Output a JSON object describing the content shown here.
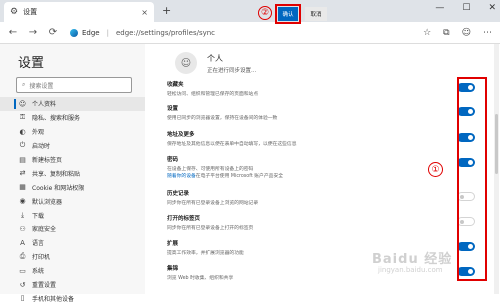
{
  "tab": {
    "title": "设置",
    "close": "×"
  },
  "newtab": "+",
  "window": {
    "minimize": "—",
    "maximize": "☐",
    "close": "✕"
  },
  "addr": {
    "back": "←",
    "forward": "→",
    "refresh": "⟳",
    "brand": "Edge",
    "sep": "|",
    "url": "edge://settings/profiles/sync",
    "star": "☆",
    "collections": "⧉",
    "more": "⋯"
  },
  "sidebar": {
    "title": "设置",
    "search_placeholder": "搜索设置",
    "items": [
      {
        "icon": "☺",
        "label": "个人资料",
        "active": true
      },
      {
        "icon": "⚿",
        "label": "隐私、搜索和服务"
      },
      {
        "icon": "◐",
        "label": "外观"
      },
      {
        "icon": "⏻",
        "label": "启动时"
      },
      {
        "icon": "▤",
        "label": "新建标签页"
      },
      {
        "icon": "⇄",
        "label": "共享、复制和粘贴"
      },
      {
        "icon": "▦",
        "label": "Cookie 和网站权限"
      },
      {
        "icon": "◉",
        "label": "默认浏览器"
      },
      {
        "icon": "⤓",
        "label": "下载"
      },
      {
        "icon": "⚇",
        "label": "家庭安全"
      },
      {
        "icon": "A",
        "label": "语言"
      },
      {
        "icon": "⎙",
        "label": "打印机"
      },
      {
        "icon": "▭",
        "label": "系统"
      },
      {
        "icon": "↺",
        "label": "重置设置"
      },
      {
        "icon": "▯",
        "label": "手机和其他设备"
      }
    ]
  },
  "profile": {
    "avatar": "☺",
    "name": "个人",
    "status": "正在进行同步设置..."
  },
  "annotations": {
    "one": "①",
    "two": "②"
  },
  "buttons": {
    "confirm": "确认",
    "cancel": "取消"
  },
  "settings": [
    {
      "title": "收藏夹",
      "desc": "轻松访问、组织和管理已保存的页面和站点",
      "on": true
    },
    {
      "title": "设置",
      "desc": "使用已同步的浏览器设置，保持在设备间的体验一致",
      "on": true
    },
    {
      "title": "地址及更多",
      "desc": "保存地址及其他信息以便在表单中自动填写，以便在这些信息",
      "on": true
    },
    {
      "title": "密码",
      "desc": "在设备上保存、可使用所有设备上的密码",
      "desc_link": "随着你的设备",
      "desc_tail": "在电子平台使用 Microsoft 账户产品安全",
      "on": true
    },
    {
      "title": "历史记录",
      "desc": "同步你在所有已登录设备上浏览的网站记录",
      "on": false
    },
    {
      "title": "打开的标签页",
      "desc": "同步你在所有已登录设备上打开的标签页",
      "on": false
    },
    {
      "title": "扩展",
      "desc": "提高工作效率，并扩展浏览器的功能",
      "on": true
    },
    {
      "title": "集锦",
      "desc": "浏览 Web 时收集、组织和共享",
      "on": true
    }
  ],
  "watermark": {
    "main": "Baidu 经验",
    "sub": "jingyan.baidu.com"
  }
}
